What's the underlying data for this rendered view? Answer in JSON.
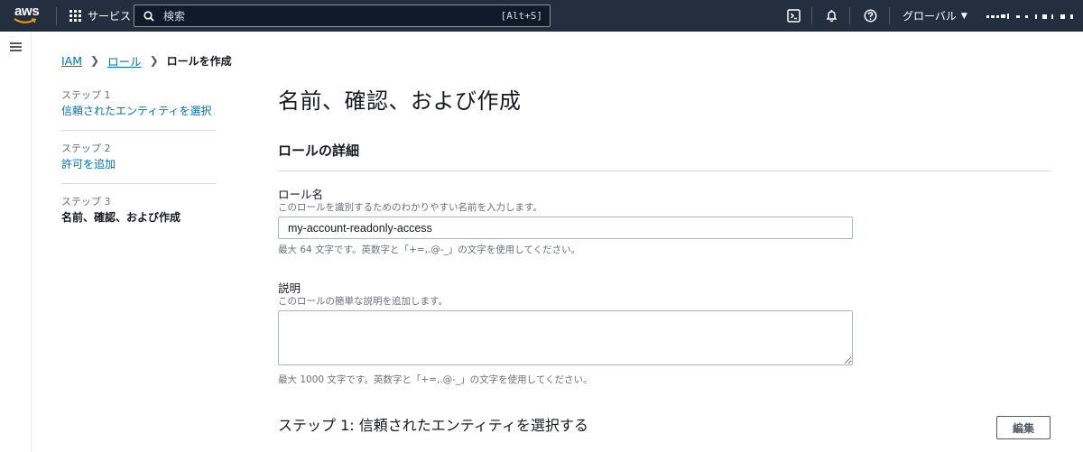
{
  "nav": {
    "logo_text": "aws",
    "services_label": "サービス",
    "search_placeholder": "検索",
    "search_shortcut": "[Alt+S]",
    "region_label": "グローバル",
    "icons": [
      "cloudshell-icon",
      "bell-icon",
      "help-icon",
      "grid-icon",
      "search-icon"
    ]
  },
  "breadcrumb": {
    "items": [
      "IAM",
      "ロール"
    ],
    "current": "ロールを作成"
  },
  "steps": [
    {
      "num": "ステップ 1",
      "title": "信頼されたエンティティを選択"
    },
    {
      "num": "ステップ 2",
      "title": "許可を追加"
    },
    {
      "num": "ステップ 3",
      "title": "名前、確認、および作成"
    }
  ],
  "main": {
    "title": "名前、確認、および作成",
    "section_title": "ロールの詳細",
    "role_name": {
      "label": "ロール名",
      "description": "このロールを識別するためのわかりやすい名前を入力します。",
      "value": "my-account-readonly-access",
      "constraint": "最大 64 文字です。英数字と「+=,.@-_」の文字を使用してください。"
    },
    "description_field": {
      "label": "説明",
      "description": "このロールの簡単な説明を追加します。",
      "value": "",
      "constraint": "最大 1000 文字です。英数字と「+=,.@-_」の文字を使用してください。"
    },
    "step1_heading": "ステップ 1: 信頼されたエンティティを選択する",
    "edit_label": "編集"
  },
  "colors": {
    "nav_bg": "#232f3e",
    "link": "#0073bb",
    "text": "#16191f",
    "muted": "#687078"
  }
}
